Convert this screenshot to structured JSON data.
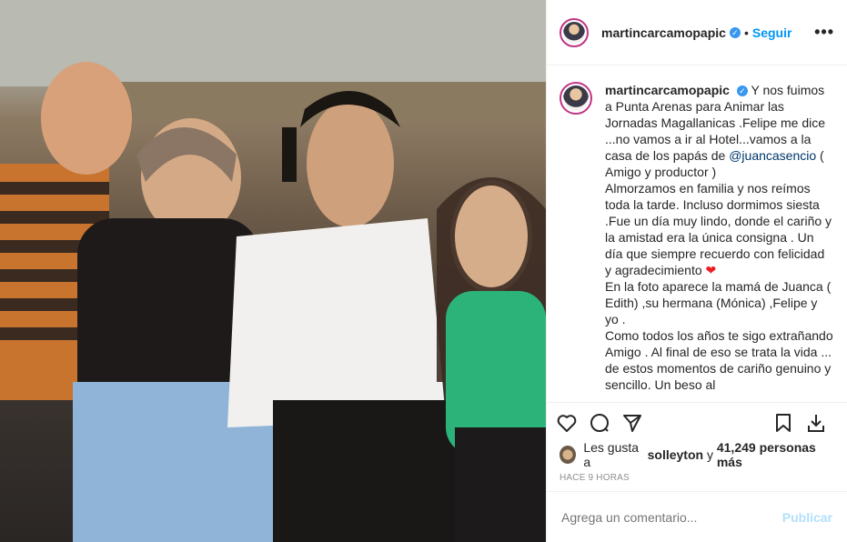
{
  "header": {
    "username": "martincarcamopapic",
    "dot": "•",
    "follow_label": "Seguir",
    "more_label": "•••"
  },
  "caption": {
    "username": "martincarcamopapic",
    "part1": "Y nos fuimos a Punta Arenas para Animar las Jornadas Magallanicas .Felipe me dice ...no vamos a ir al Hotel...vamos a la casa de los papás de",
    "mention": "@juancasencio",
    "part2": "( Amigo y productor )",
    "para2": "Almorzamos en familia y nos reímos toda la tarde. Incluso dormimos siesta .Fue un día muy lindo, donde el cariño y la amistad era la única consigna . Un día que siempre recuerdo con felicidad y agradecimiento",
    "heart": "❤",
    "para3": "En la foto aparece la mamá de Juanca ( Edith) ,su hermana (Mónica) ,Felipe y yo .",
    "para4": "Como todos los años te sigo extrañando Amigo . Al final de eso se trata la vida ... de estos momentos de cariño genuino y sencillo. Un beso al"
  },
  "likes": {
    "prefix": "Les gusta a",
    "user": "solleyton",
    "middle": "y",
    "count": "41,249 personas más"
  },
  "timestamp": "HACE 9 HORAS",
  "comment": {
    "placeholder": "Agrega un comentario...",
    "post_label": "Publicar"
  },
  "colors": {
    "link_blue": "#0095f6",
    "verified_blue": "#3897f0",
    "muted": "#8e8e8e"
  },
  "icons": [
    "heart-icon",
    "comment-icon",
    "share-icon",
    "bookmark-icon",
    "download-icon",
    "verified-icon"
  ]
}
